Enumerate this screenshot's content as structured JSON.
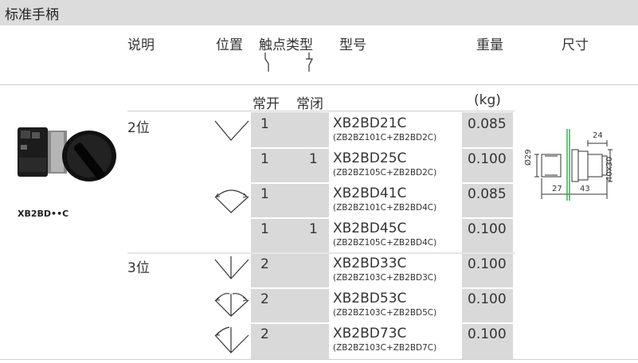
{
  "title": "标准手柄",
  "headers": {
    "desc": "说明",
    "position": "位置",
    "contact_type": "触点类型",
    "model": "型号",
    "weight": "重量",
    "size": "尺寸"
  },
  "subheaders": {
    "no": "常开",
    "nc": "常闭",
    "weight_unit": "(kg)"
  },
  "product_label": "XB2BD••C",
  "groups": [
    {
      "label": "2位"
    },
    {
      "label": "3位"
    }
  ],
  "rows": [
    {
      "no": "1",
      "nc": "",
      "model": "XB2BD21C",
      "sub": "(ZB2BZ101C+ZB2BD2C)",
      "weight": "0.085"
    },
    {
      "no": "1",
      "nc": "1",
      "model": "XB2BD25C",
      "sub": "(ZB2BZ105C+ZB2BD2C)",
      "weight": "0.100"
    },
    {
      "no": "1",
      "nc": "",
      "model": "XB2BD41C",
      "sub": "(ZB2BZ101C+ZB2BD4C)",
      "weight": "0.085"
    },
    {
      "no": "1",
      "nc": "1",
      "model": "XB2BD45C",
      "sub": "(ZB2BZ105C+ZB2BD4C)",
      "weight": "0.100"
    },
    {
      "no": "2",
      "nc": "",
      "model": "XB2BD33C",
      "sub": "(ZB2BZ103C+ZB2BD3C)",
      "weight": "0.100"
    },
    {
      "no": "2",
      "nc": "",
      "model": "XB2BD53C",
      "sub": "(ZB2BZ103C+ZB2BD5C)",
      "weight": "0.100"
    },
    {
      "no": "2",
      "nc": "",
      "model": "XB2BD73C",
      "sub": "(ZB2BZ103C+ZB2BD7C)",
      "weight": "0.100"
    }
  ],
  "dimensions": {
    "top": "24",
    "dia": "Ø29",
    "side": "40x30",
    "left": "27",
    "right": "43"
  },
  "icons": [
    "selector-switch-photo-icon",
    "handle-position-diagram-icon",
    "contact-no-icon",
    "contact-nc-icon",
    "dimension-drawing-icon"
  ],
  "colors": {
    "title_bg": "#dcdcdc",
    "cell_gray": "#d9d9d9",
    "text": "#333333"
  }
}
